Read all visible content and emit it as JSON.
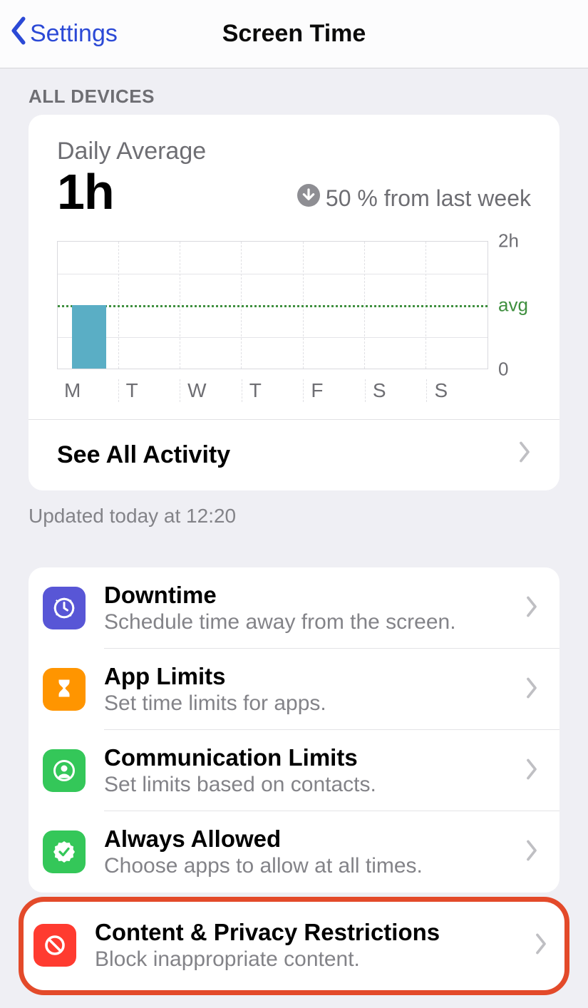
{
  "nav": {
    "back_label": "Settings",
    "title": "Screen Time"
  },
  "section_all_devices": "ALL DEVICES",
  "daily": {
    "label": "Daily Average",
    "value": "1h",
    "delta": "50 % from last week",
    "footer": "Updated today at 12:20"
  },
  "see_all": "See All Activity",
  "chart_data": {
    "type": "bar",
    "categories": [
      "M",
      "T",
      "W",
      "T",
      "F",
      "S",
      "S"
    ],
    "values": [
      1,
      0,
      0,
      0,
      0,
      0,
      0
    ],
    "ylabel": "",
    "ylim": [
      0,
      2
    ],
    "ytick_top": "2h",
    "ytick_bottom": "0",
    "avg_label": "avg",
    "avg_value": 1
  },
  "options": [
    {
      "id": "downtime",
      "title": "Downtime",
      "sub": "Schedule time away from the screen.",
      "icon": "clock-icon",
      "color": "purple"
    },
    {
      "id": "app-limits",
      "title": "App Limits",
      "sub": "Set time limits for apps.",
      "icon": "hourglass-icon",
      "color": "orange"
    },
    {
      "id": "comm-limits",
      "title": "Communication Limits",
      "sub": "Set limits based on contacts.",
      "icon": "person-icon",
      "color": "green"
    },
    {
      "id": "always-allowed",
      "title": "Always Allowed",
      "sub": "Choose apps to allow at all times.",
      "icon": "checkmark-seal-icon",
      "color": "green"
    },
    {
      "id": "content-privacy",
      "title": "Content & Privacy Restrictions",
      "sub": "Block inappropriate content.",
      "icon": "nosign-icon",
      "color": "red",
      "highlighted": true
    }
  ]
}
